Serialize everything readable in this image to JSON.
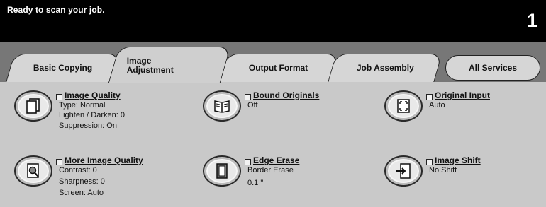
{
  "status": {
    "message": "Ready to scan your job.",
    "job_count": "1"
  },
  "tabs": [
    {
      "label": "Basic Copying"
    },
    {
      "label": "Image Adjustment",
      "line1": "Image",
      "line2": "Adjustment"
    },
    {
      "label": "Output Format"
    },
    {
      "label": "Job Assembly"
    },
    {
      "label": "All Services"
    }
  ],
  "active_tab": "Image Adjustment",
  "features": {
    "image_quality": {
      "title": "Image Quality",
      "lines": [
        "Type: Normal",
        "Lighten / Darken: 0",
        "Suppression: On"
      ],
      "icon": "document-pages-icon"
    },
    "bound_originals": {
      "title": "Bound Originals",
      "lines": [
        "Off"
      ],
      "icon": "open-book-icon"
    },
    "original_input": {
      "title": "Original Input",
      "lines": [
        "Auto"
      ],
      "icon": "page-corners-icon"
    },
    "more_image_quality": {
      "title": "More Image Quality",
      "lines": [
        "Contrast: 0",
        "Sharpness: 0",
        "Screen: Auto"
      ],
      "icon": "magnifier-document-icon"
    },
    "edge_erase": {
      "title": "Edge Erase",
      "lines": [
        "Border Erase",
        "0.1 \""
      ],
      "icon": "framed-page-icon"
    },
    "image_shift": {
      "title": "Image Shift",
      "lines": [
        "No Shift"
      ],
      "icon": "arrow-into-page-icon"
    }
  },
  "colors": {
    "status_bar": "#000000",
    "tab_strip": "#777777",
    "panel": "#c9c9c9",
    "tab": "#d6d6d6"
  }
}
